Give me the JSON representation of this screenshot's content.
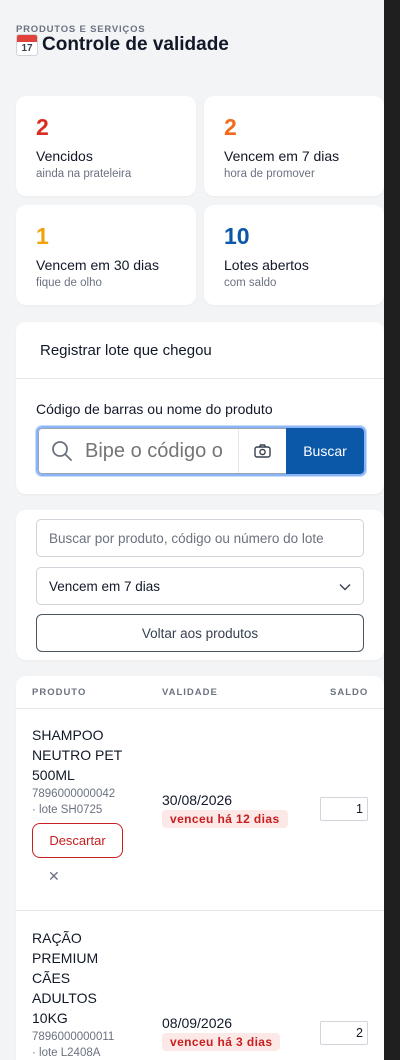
{
  "header": {
    "eyebrow": "PRODUTOS E SERVIÇOS",
    "calendar_day": "17",
    "title": "Controle de validade"
  },
  "stats": [
    {
      "value": "2",
      "label": "Vencidos",
      "sub": "ainda na prateleira",
      "color": "#d92d20"
    },
    {
      "value": "2",
      "label": "Vencem em 7 dias",
      "sub": "hora de promover",
      "color": "#f26b1d"
    },
    {
      "value": "1",
      "label": "Vencem em 30 dias",
      "sub": "fique de olho",
      "color": "#f0a20b"
    },
    {
      "value": "10",
      "label": "Lotes abertos",
      "sub": "com saldo",
      "color": "#0b57a8"
    }
  ],
  "register": {
    "title": "Registrar lote que chegou",
    "field_label": "Código de barras ou nome do produto",
    "placeholder": "Bipe o código o",
    "search_button": "Buscar"
  },
  "filters": {
    "search_placeholder": "Buscar por produto, código ou número do lote",
    "select_value": "Vencem em 7 dias",
    "back_button": "Voltar aos produtos"
  },
  "table": {
    "columns": [
      "PRODUTO",
      "VALIDADE",
      "SALDO"
    ],
    "rows": [
      {
        "name_lines": [
          "SHAMPOO",
          "NEUTRO PET",
          "500ML"
        ],
        "code": "7896000000042",
        "lot": "· lote SH0725",
        "date": "30/08/2026",
        "status": "venceu há 12 dias",
        "qty": "1",
        "discard": "Descartar",
        "close": "✕"
      },
      {
        "name_lines": [
          "RAÇÃO",
          "PREMIUM",
          "CÃES",
          "ADULTOS",
          "10KG"
        ],
        "code": "7896000000011",
        "lot": "· lote L2408A",
        "date": "08/09/2026",
        "status": "venceu há 3 dias",
        "qty": "2"
      }
    ]
  },
  "colors": {
    "accent": "#0b57a8",
    "danger": "#c81e1e"
  }
}
